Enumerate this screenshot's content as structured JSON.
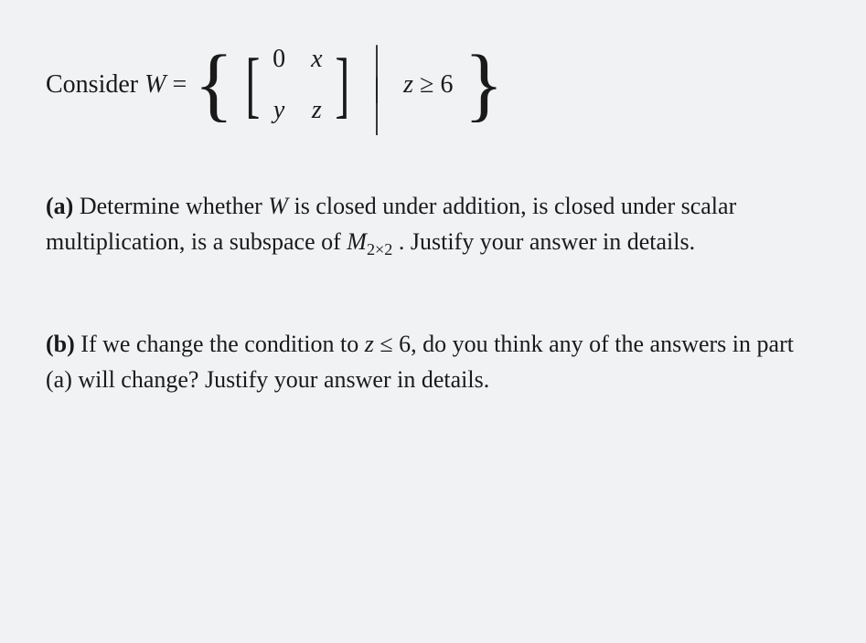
{
  "consider": {
    "prefix": "Consider ",
    "varName": "W",
    "equals": " = "
  },
  "matrix": {
    "r1c1": "0",
    "r1c2": "x",
    "r2c1": "y",
    "r2c2": "z"
  },
  "setCondition": {
    "var": "z",
    "rel": " ≥ ",
    "val": "6"
  },
  "partA": {
    "label": "(a)",
    "text1": " Determine whether ",
    "varW": "W",
    "text2": " is closed under addition, is closed under scalar multiplication, is a subspace of ",
    "mspace": "M",
    "msub": "2×2",
    "text3": " . Justify your answer in details."
  },
  "partB": {
    "label": "(b)",
    "text1": " If we change the condition to ",
    "zvar": "z",
    "rel": " ≤ ",
    "val": "6",
    "text2": ", do you think any of the answers in part (a) will change? Justify your answer in details."
  }
}
